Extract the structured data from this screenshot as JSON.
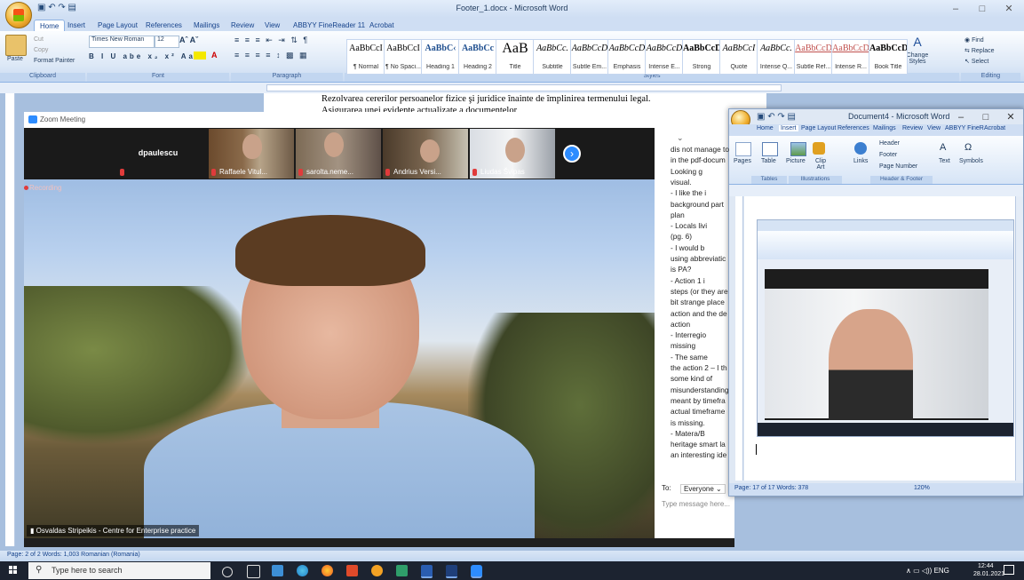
{
  "word": {
    "title": "Footer_1.docx - Microsoft Word",
    "qat": "▣ ↶ ↷ ▤",
    "tabs": [
      "Home",
      "Insert",
      "Page Layout",
      "References",
      "Mailings",
      "Review",
      "View",
      "ABBYY FineReader 11",
      "Acrobat"
    ],
    "ribbon": {
      "paste": "Paste",
      "cut": "Cut",
      "copy": "Copy",
      "format_painter": "Format Painter",
      "font_name": "Times New Roman",
      "font_size": "12",
      "groups": {
        "clipboard": "Clipboard",
        "font": "Font",
        "paragraph": "Paragraph",
        "styles": "Styles",
        "editing": "Editing"
      },
      "styles": [
        {
          "sample": "AaBbCcI",
          "name": "¶ Normal"
        },
        {
          "sample": "AaBbCcI",
          "name": "¶ No Spaci..."
        },
        {
          "sample": "AaBbC‹",
          "name": "Heading 1"
        },
        {
          "sample": "AaBbCc",
          "name": "Heading 2"
        },
        {
          "sample": "AaB",
          "name": "Title"
        },
        {
          "sample": "AaBbCc.",
          "name": "Subtitle"
        },
        {
          "sample": "AaBbCcD",
          "name": "Subtle Em..."
        },
        {
          "sample": "AaBbCcD",
          "name": "Emphasis"
        },
        {
          "sample": "AaBbCcD",
          "name": "Intense E..."
        },
        {
          "sample": "AaBbCcD",
          "name": "Strong"
        },
        {
          "sample": "AaBbCcI",
          "name": "Quote"
        },
        {
          "sample": "AaBbCc.",
          "name": "Intense Q..."
        },
        {
          "sample": "AaBbCcD",
          "name": "Subtle Ref..."
        },
        {
          "sample": "AaBbCcD",
          "name": "Intense R..."
        },
        {
          "sample": "AaBbCcD",
          "name": "Book Title"
        }
      ],
      "change_styles": "Change Styles",
      "find": "Find",
      "replace": "Replace",
      "select": "Select"
    },
    "doc_line1": "Rezolvarea cererilor persoanelor fizice şi juridice înainte de împlinirea termenului legal.",
    "doc_line2": "Asigurarea unei evidente actualizate a documentelor",
    "status": "Page: 2 of 2   Words: 1,003        Romanian (Romania)"
  },
  "zoom": {
    "title": "Zoom Meeting",
    "recording": "Recording",
    "participants": [
      "dpaulescu",
      "Raffaele Vitul...",
      "sarolta.neme...",
      "Andrius Versi...",
      "Liudas Švipas"
    ],
    "speaker": "Osvaldas Stripeikis - Centre for Enterprise practice",
    "chat_lines": [
      "dis not manage to",
      "in the pdf-docum",
      "      Looking g",
      "visual.",
      "-       I like the i",
      "background part",
      "plan",
      "-       Locals livi",
      "(pg. 6)",
      "-       I would b",
      "using abbreviatic",
      "is PA?",
      "-       Action 1 i",
      "steps (or they are",
      "bit strange place",
      "action and the de",
      "action",
      "-       Interregio",
      "missing",
      "-       The same",
      "the action 2 – I th",
      "some kind of",
      "misunderstanding",
      "meant by timefra",
      "actual timeframe",
      "is missing.",
      "-       Matera/B",
      "heritage smart la",
      "an interesting ide"
    ],
    "chat_to_label": "To:",
    "chat_to_value": "Everyone ⌄",
    "chat_placeholder": "Type message here..."
  },
  "word2": {
    "title": "Document4 - Microsoft Word",
    "tabs": [
      "Home",
      "Insert",
      "Page Layout",
      "References",
      "Mailings",
      "Review",
      "View",
      "ABBYY FineR",
      "Acrobat"
    ],
    "buttons": [
      "Pages",
      "Table",
      "Picture",
      "Clip Art",
      "Links",
      "Header",
      "Footer",
      "Page Number",
      "Text",
      "Symbols"
    ],
    "groups": [
      "Tables",
      "Illustrations",
      "Header & Footer"
    ],
    "status": "Page: 17 of 17   Words: 378",
    "zoom_level": "120%"
  },
  "taskbar": {
    "search_placeholder": "Type here to search",
    "tray": "∧  ▭  ◁))  ENG",
    "time": "12:44",
    "date": "28.01.2021"
  },
  "colors": {
    "zoom_blue": "#2d8cff",
    "word_blue": "#15428b",
    "recording_red": "#e03b3b"
  }
}
